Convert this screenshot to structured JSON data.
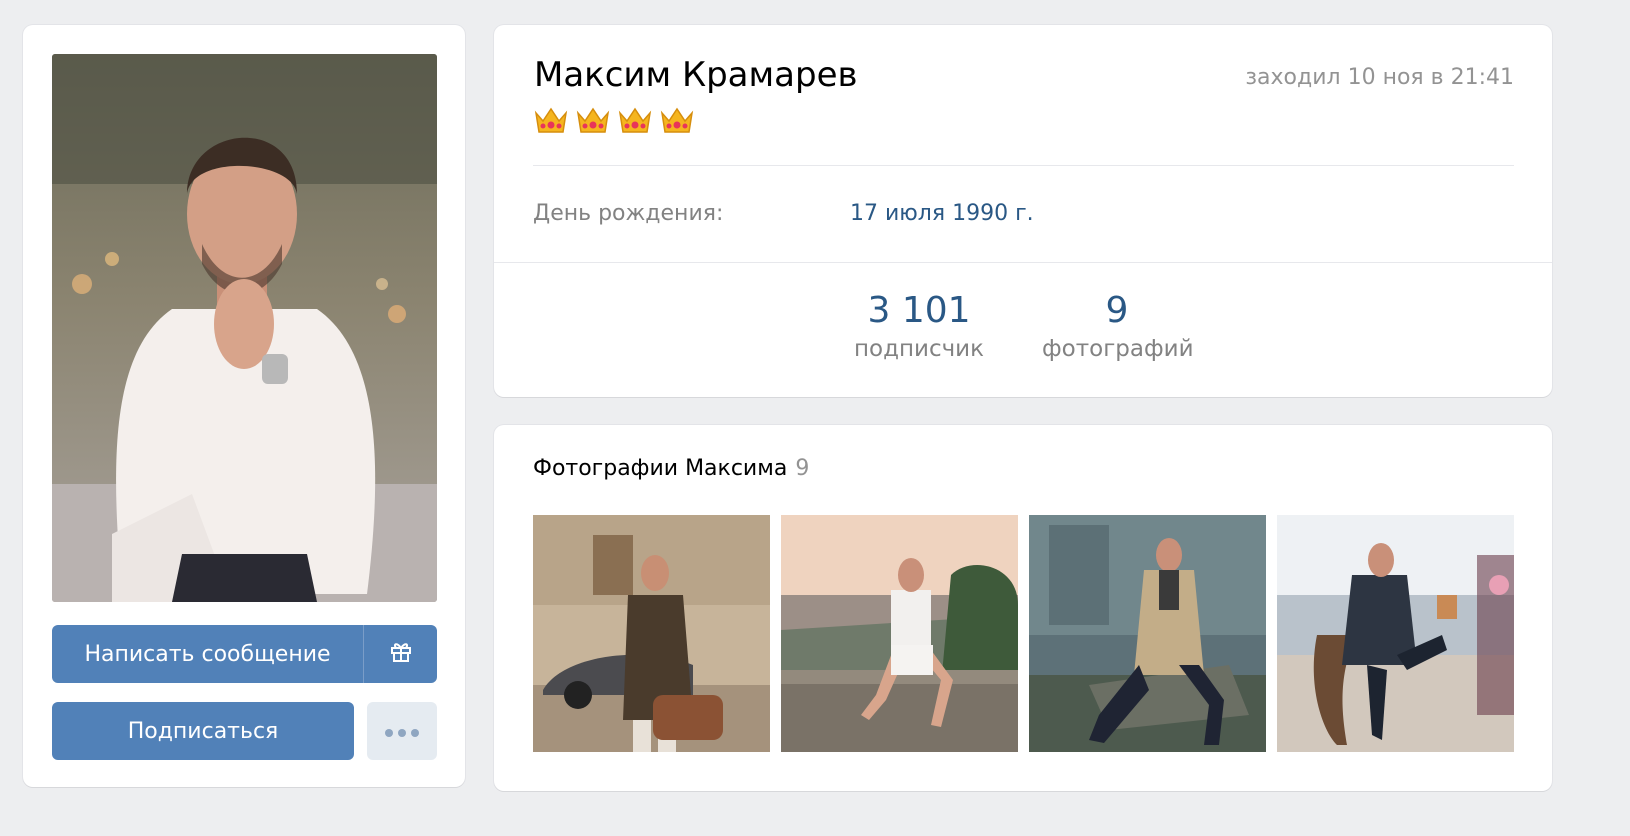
{
  "profile": {
    "name": "Максим Крамарев",
    "status_emoji": [
      "crown",
      "crown",
      "crown",
      "crown"
    ],
    "last_seen": "заходил 10 ноя в 21:41",
    "birthday_label": "День рождения:",
    "birthday_value": "17 июля 1990 г."
  },
  "counters": {
    "subscribers_value": "3 101",
    "subscribers_label": "подписчик",
    "photos_value": "9",
    "photos_label": "фотографий"
  },
  "actions": {
    "message_label": "Написать сообщение",
    "gift_icon": "gift-icon",
    "subscribe_label": "Подписаться",
    "more_icon": "more-icon"
  },
  "photos": {
    "title": "Фотографии Максима",
    "count": "9"
  },
  "colors": {
    "background": "#edeef0",
    "primary_button": "#5181b8",
    "link": "#2a5885",
    "secondary_text": "#828282"
  }
}
